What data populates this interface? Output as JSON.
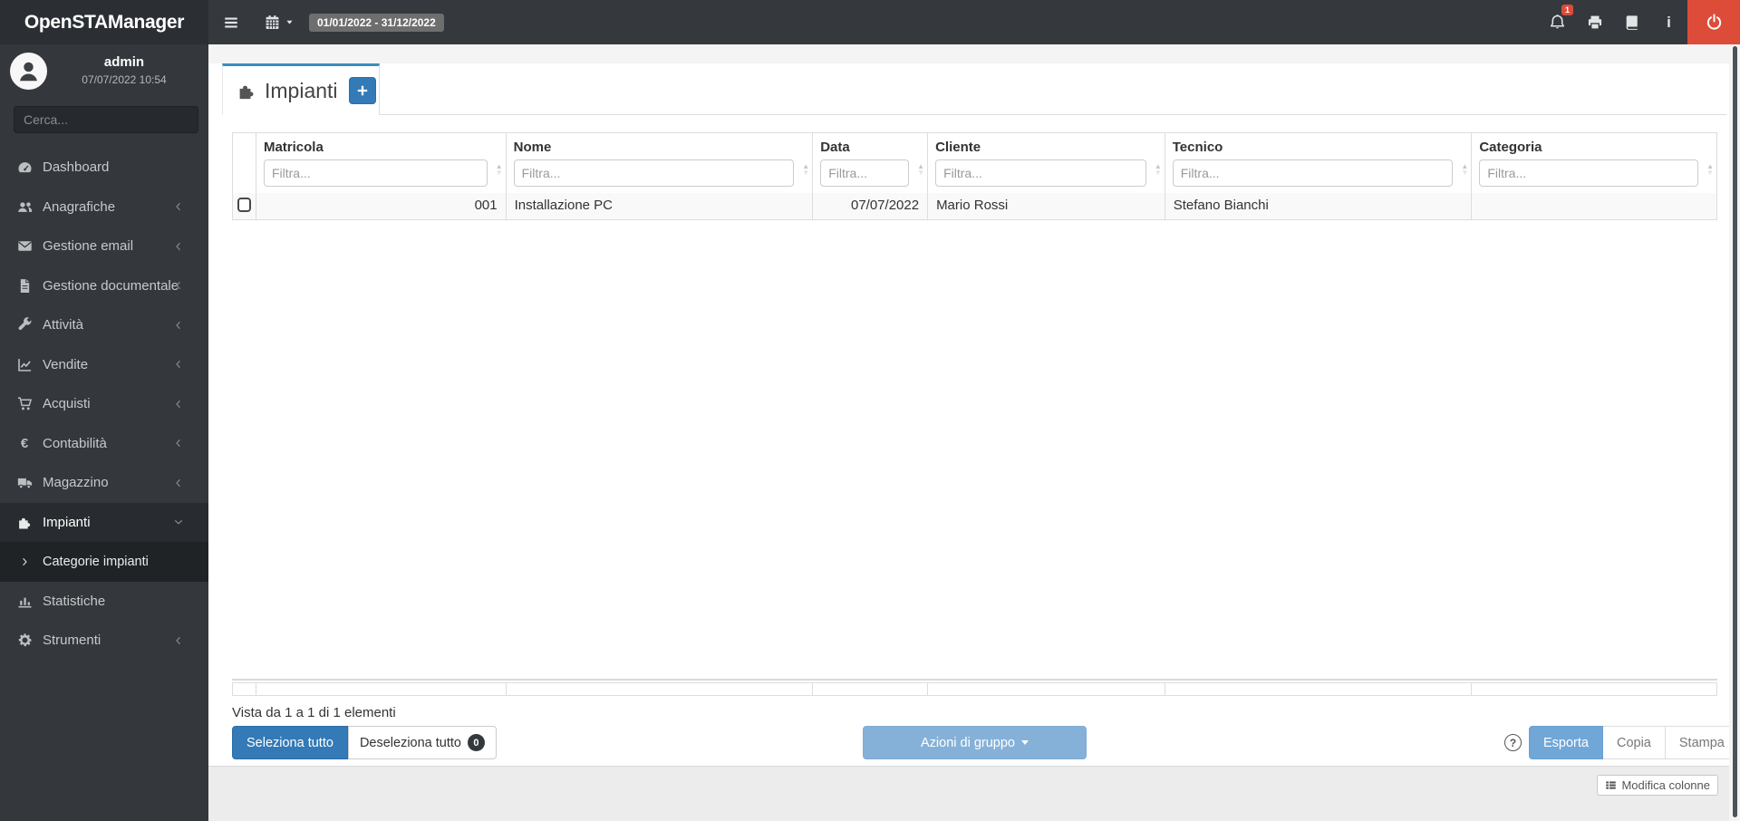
{
  "topbar": {
    "logo": "OpenSTAManager",
    "date_range": "01/01/2022 - 31/12/2022",
    "notification_badge": "1",
    "info_glyph": "i"
  },
  "sidebar": {
    "user": {
      "name": "admin",
      "timestamp": "07/07/2022 10:54"
    },
    "search_placeholder": "Cerca...",
    "items": [
      {
        "label": "Dashboard",
        "icon": "dashboard",
        "chevron": null,
        "active": false,
        "submenu": false
      },
      {
        "label": "Anagrafiche",
        "icon": "users",
        "chevron": "left",
        "active": false,
        "submenu": false
      },
      {
        "label": "Gestione email",
        "icon": "envelope",
        "chevron": "left",
        "active": false,
        "submenu": false
      },
      {
        "label": "Gestione documentale",
        "icon": "file",
        "chevron": "left",
        "active": false,
        "submenu": false
      },
      {
        "label": "Attività",
        "icon": "wrench",
        "chevron": "left",
        "active": false,
        "submenu": false
      },
      {
        "label": "Vendite",
        "icon": "chartline",
        "chevron": "left",
        "active": false,
        "submenu": false
      },
      {
        "label": "Acquisti",
        "icon": "cart",
        "chevron": "left",
        "active": false,
        "submenu": false
      },
      {
        "label": "Contabilità",
        "icon": "euro",
        "chevron": "left",
        "active": false,
        "submenu": false
      },
      {
        "label": "Magazzino",
        "icon": "truck",
        "chevron": "left",
        "active": false,
        "submenu": false
      },
      {
        "label": "Impianti",
        "icon": "puzzle",
        "chevron": "down",
        "active": true,
        "submenu": false
      },
      {
        "label": "Categorie impianti",
        "icon": "angle-right",
        "chevron": null,
        "active": false,
        "submenu": true
      },
      {
        "label": "Statistiche",
        "icon": "chartbar",
        "chevron": null,
        "active": false,
        "submenu": false
      },
      {
        "label": "Strumenti",
        "icon": "gear",
        "chevron": "left",
        "active": false,
        "submenu": false
      }
    ]
  },
  "main": {
    "tab": {
      "label": "Impianti",
      "add_icon": "plus"
    },
    "table": {
      "filter_placeholder": "Filtra...",
      "columns": [
        {
          "label": "Matricola",
          "align": "right"
        },
        {
          "label": "Nome",
          "align": "left"
        },
        {
          "label": "Data",
          "align": "right"
        },
        {
          "label": "Cliente",
          "align": "left"
        },
        {
          "label": "Tecnico",
          "align": "left"
        },
        {
          "label": "Categoria",
          "align": "left"
        }
      ],
      "rows": [
        {
          "checked": false,
          "cells": [
            "001",
            "Installazione PC",
            "07/07/2022",
            "Mario Rossi",
            "Stefano Bianchi",
            ""
          ]
        }
      ],
      "summary": "Vista da 1 a 1 di 1 elementi"
    },
    "actions": {
      "select_all": "Seleziona tutto",
      "deselect_all": "Deseleziona tutto",
      "deselect_count": "0",
      "group_actions": "Azioni di gruppo",
      "export": "Esporta",
      "copy": "Copia",
      "print": "Stampa",
      "edit_columns": "Modifica colonne"
    },
    "colors": {
      "accent_blue": "#3c8dbc",
      "primary_button": "#337ab7",
      "group_button": "#85b1d8",
      "export_button": "#71a7d7",
      "danger_red": "#dd4b39"
    }
  }
}
